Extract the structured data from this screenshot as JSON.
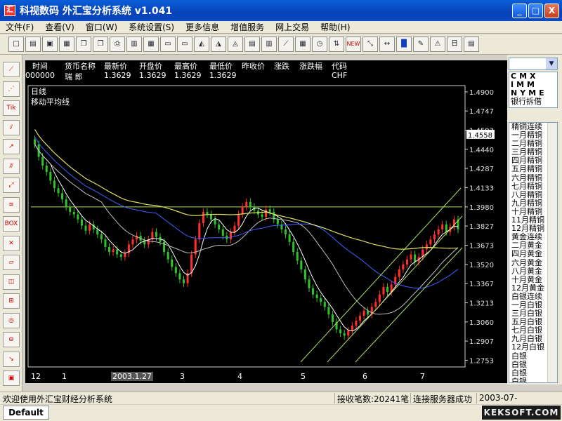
{
  "window": {
    "title": "科视数码  外汇宝分析系统  v1.041",
    "minimize": "_",
    "maximize": "□",
    "close": "X"
  },
  "menu": [
    "文件(F)",
    "查看(V)",
    "窗口(W)",
    "系统设置(S)",
    "更多信息",
    "增值服务",
    "网上交易",
    "帮助(H)"
  ],
  "toolbar_icons": [
    "new-icon",
    "open-icon",
    "folder-icon",
    "save-icon",
    "copy-icon",
    "copy2-icon",
    "print-icon",
    "layout-icon",
    "grid-icon",
    "window-icon",
    "window2-icon",
    "chart-icon",
    "chart2-icon",
    "chart3-icon",
    "book-icon",
    "indicator-icon",
    "draw-icon",
    "table-icon",
    "clock-icon",
    "alert-icon",
    "new-badge-icon",
    "line-icon",
    "arrow-icon",
    "blue-square-icon",
    "edit-icon",
    "warning-icon",
    "dropdown-icon",
    "list-icon"
  ],
  "toolbar_glyphs": [
    "□",
    "▤",
    "▣",
    "▦",
    "❐",
    "❐",
    "⎙",
    "▥",
    "▦",
    "▭",
    "▭",
    "◭",
    "◮",
    "◬",
    "▤",
    "▥",
    "⟋",
    "▦",
    "◷",
    "⇅",
    "NEW",
    "⤡",
    "↔",
    "█",
    "✎",
    "⚠",
    "日",
    "▤"
  ],
  "left_tools": [
    {
      "name": "fib-line-tool",
      "glyph": "⟋"
    },
    {
      "name": "fan-tool",
      "glyph": "⋰"
    },
    {
      "name": "tik-tool",
      "glyph": "Tik"
    },
    {
      "name": "channel-tool",
      "glyph": "⫽"
    },
    {
      "name": "trend-tool",
      "glyph": "↗"
    },
    {
      "name": "parallel-tool",
      "glyph": "⫻"
    },
    {
      "name": "ray-tool",
      "glyph": "⤢"
    },
    {
      "name": "wave-tool",
      "glyph": "≋"
    },
    {
      "name": "box-tool",
      "glyph": "BOX"
    },
    {
      "name": "delete-tool",
      "glyph": "✕"
    },
    {
      "name": "eraser-tool",
      "glyph": "▱"
    },
    {
      "name": "chart-tool",
      "glyph": "◫"
    },
    {
      "name": "zoom-tool",
      "glyph": "⊞"
    },
    {
      "name": "target-tool",
      "glyph": "◎"
    },
    {
      "name": "circle-tool",
      "glyph": "⊖"
    },
    {
      "name": "trend2-tool",
      "glyph": "↘"
    },
    {
      "name": "mark-tool",
      "glyph": "▣"
    }
  ],
  "quote": {
    "headers": [
      "时间",
      "货币名称",
      "最新价",
      "开盘价",
      "最高价",
      "最低价",
      "昨收价",
      "涨跌",
      "涨跌幅",
      "代码"
    ],
    "values": [
      "000000",
      "瑞  郎",
      "1.3629",
      "1.3629",
      "1.3629",
      "1.3629",
      "",
      "",
      "",
      "CHF"
    ]
  },
  "chart": {
    "period_label": "日线",
    "indicator_label": "移动平均线",
    "price_ticks": [
      "1.4900",
      "1.4747",
      "1.4593",
      "1.4440",
      "1.4287",
      "1.4133",
      "1.3980",
      "1.3827",
      "1.3673",
      "1.3520",
      "1.3367",
      "1.3213",
      "1.3060",
      "1.2907",
      "1.2753"
    ],
    "current_price_tag": "1.4558",
    "x_ticks": [
      "12",
      "1",
      "2003.1.27",
      "3",
      "4",
      "5",
      "6",
      "7"
    ]
  },
  "chart_data": {
    "type": "candlestick",
    "title": "",
    "y_range": [
      1.27,
      1.495
    ],
    "y_ticks": [
      1.49,
      1.4747,
      1.4593,
      1.444,
      1.4287,
      1.4133,
      1.398,
      1.3827,
      1.3673,
      1.352,
      1.3367,
      1.3213,
      1.306,
      1.2907,
      1.2753
    ],
    "x_labels": [
      "12",
      "1",
      "2003.1.27",
      "3",
      "4",
      "5",
      "6",
      "7"
    ],
    "horizontal_line": 1.398,
    "closes": [
      1.448,
      1.438,
      1.431,
      1.426,
      1.419,
      1.413,
      1.409,
      1.404,
      1.398,
      1.394,
      1.392,
      1.388,
      1.383,
      1.379,
      1.384,
      1.38,
      1.376,
      1.372,
      1.366,
      1.362,
      1.364,
      1.36,
      1.358,
      1.361,
      1.368,
      1.372,
      1.375,
      1.371,
      1.368,
      1.372,
      1.378,
      1.374,
      1.37,
      1.362,
      1.356,
      1.35,
      1.345,
      1.34,
      1.337,
      1.345,
      1.36,
      1.372,
      1.385,
      1.394,
      1.392,
      1.388,
      1.384,
      1.38,
      1.375,
      1.372,
      1.378,
      1.383,
      1.392,
      1.398,
      1.402,
      1.398,
      1.395,
      1.392,
      1.39,
      1.396,
      1.394,
      1.388,
      1.384,
      1.38,
      1.376,
      1.37,
      1.362,
      1.355,
      1.348,
      1.34,
      1.333,
      1.328,
      1.325,
      1.322,
      1.318,
      1.312,
      1.306,
      1.3,
      1.297,
      1.295,
      1.299,
      1.303,
      1.307,
      1.311,
      1.315,
      1.312,
      1.318,
      1.322,
      1.328,
      1.334,
      1.33,
      1.336,
      1.342,
      1.348,
      1.352,
      1.356,
      1.36,
      1.354,
      1.358,
      1.364,
      1.368,
      1.372,
      1.376,
      1.38,
      1.384,
      1.378,
      1.382,
      1.388,
      1.38
    ]
  },
  "right_panel": {
    "grid_rows": [
      "CMX",
      "IMM",
      "NYME"
    ],
    "grid_last": "银行拆借",
    "list": [
      "精铜连续",
      "一月精铜",
      "二月精铜",
      "三月精铜",
      "四月精铜",
      "五月精铜",
      "六月精铜",
      "七月精铜",
      "八月精铜",
      "九月精铜",
      "十月精铜",
      "11月精铜",
      "12月精铜",
      "黄金连续",
      "二月黄金",
      "四月黄金",
      "六月黄金",
      "八月黄金",
      "十月黄金",
      "12月黄金",
      "白银连续",
      "一月白银",
      "三月白银",
      "五月白银",
      "七月白银",
      "九月白银",
      "12月白银",
      "白银",
      "白银",
      "白银",
      "白银"
    ]
  },
  "status": {
    "message": "欢迎使用外汇宝财经分析系统",
    "received": "接收笔数:20241笔",
    "server": "连接服务器成功",
    "date": "2003-07-"
  },
  "bottom": {
    "tab": "Default",
    "watermark": "KEKSOFT.COM"
  },
  "colors": {
    "up_candle": "#ff3030",
    "down_candle": "#30c030",
    "ma_yellow": "#e0e060",
    "ma_blue": "#4060ff",
    "ma_white": "#c0c0c0",
    "axis": "#e0e0e0",
    "channel": "#b0e060"
  }
}
